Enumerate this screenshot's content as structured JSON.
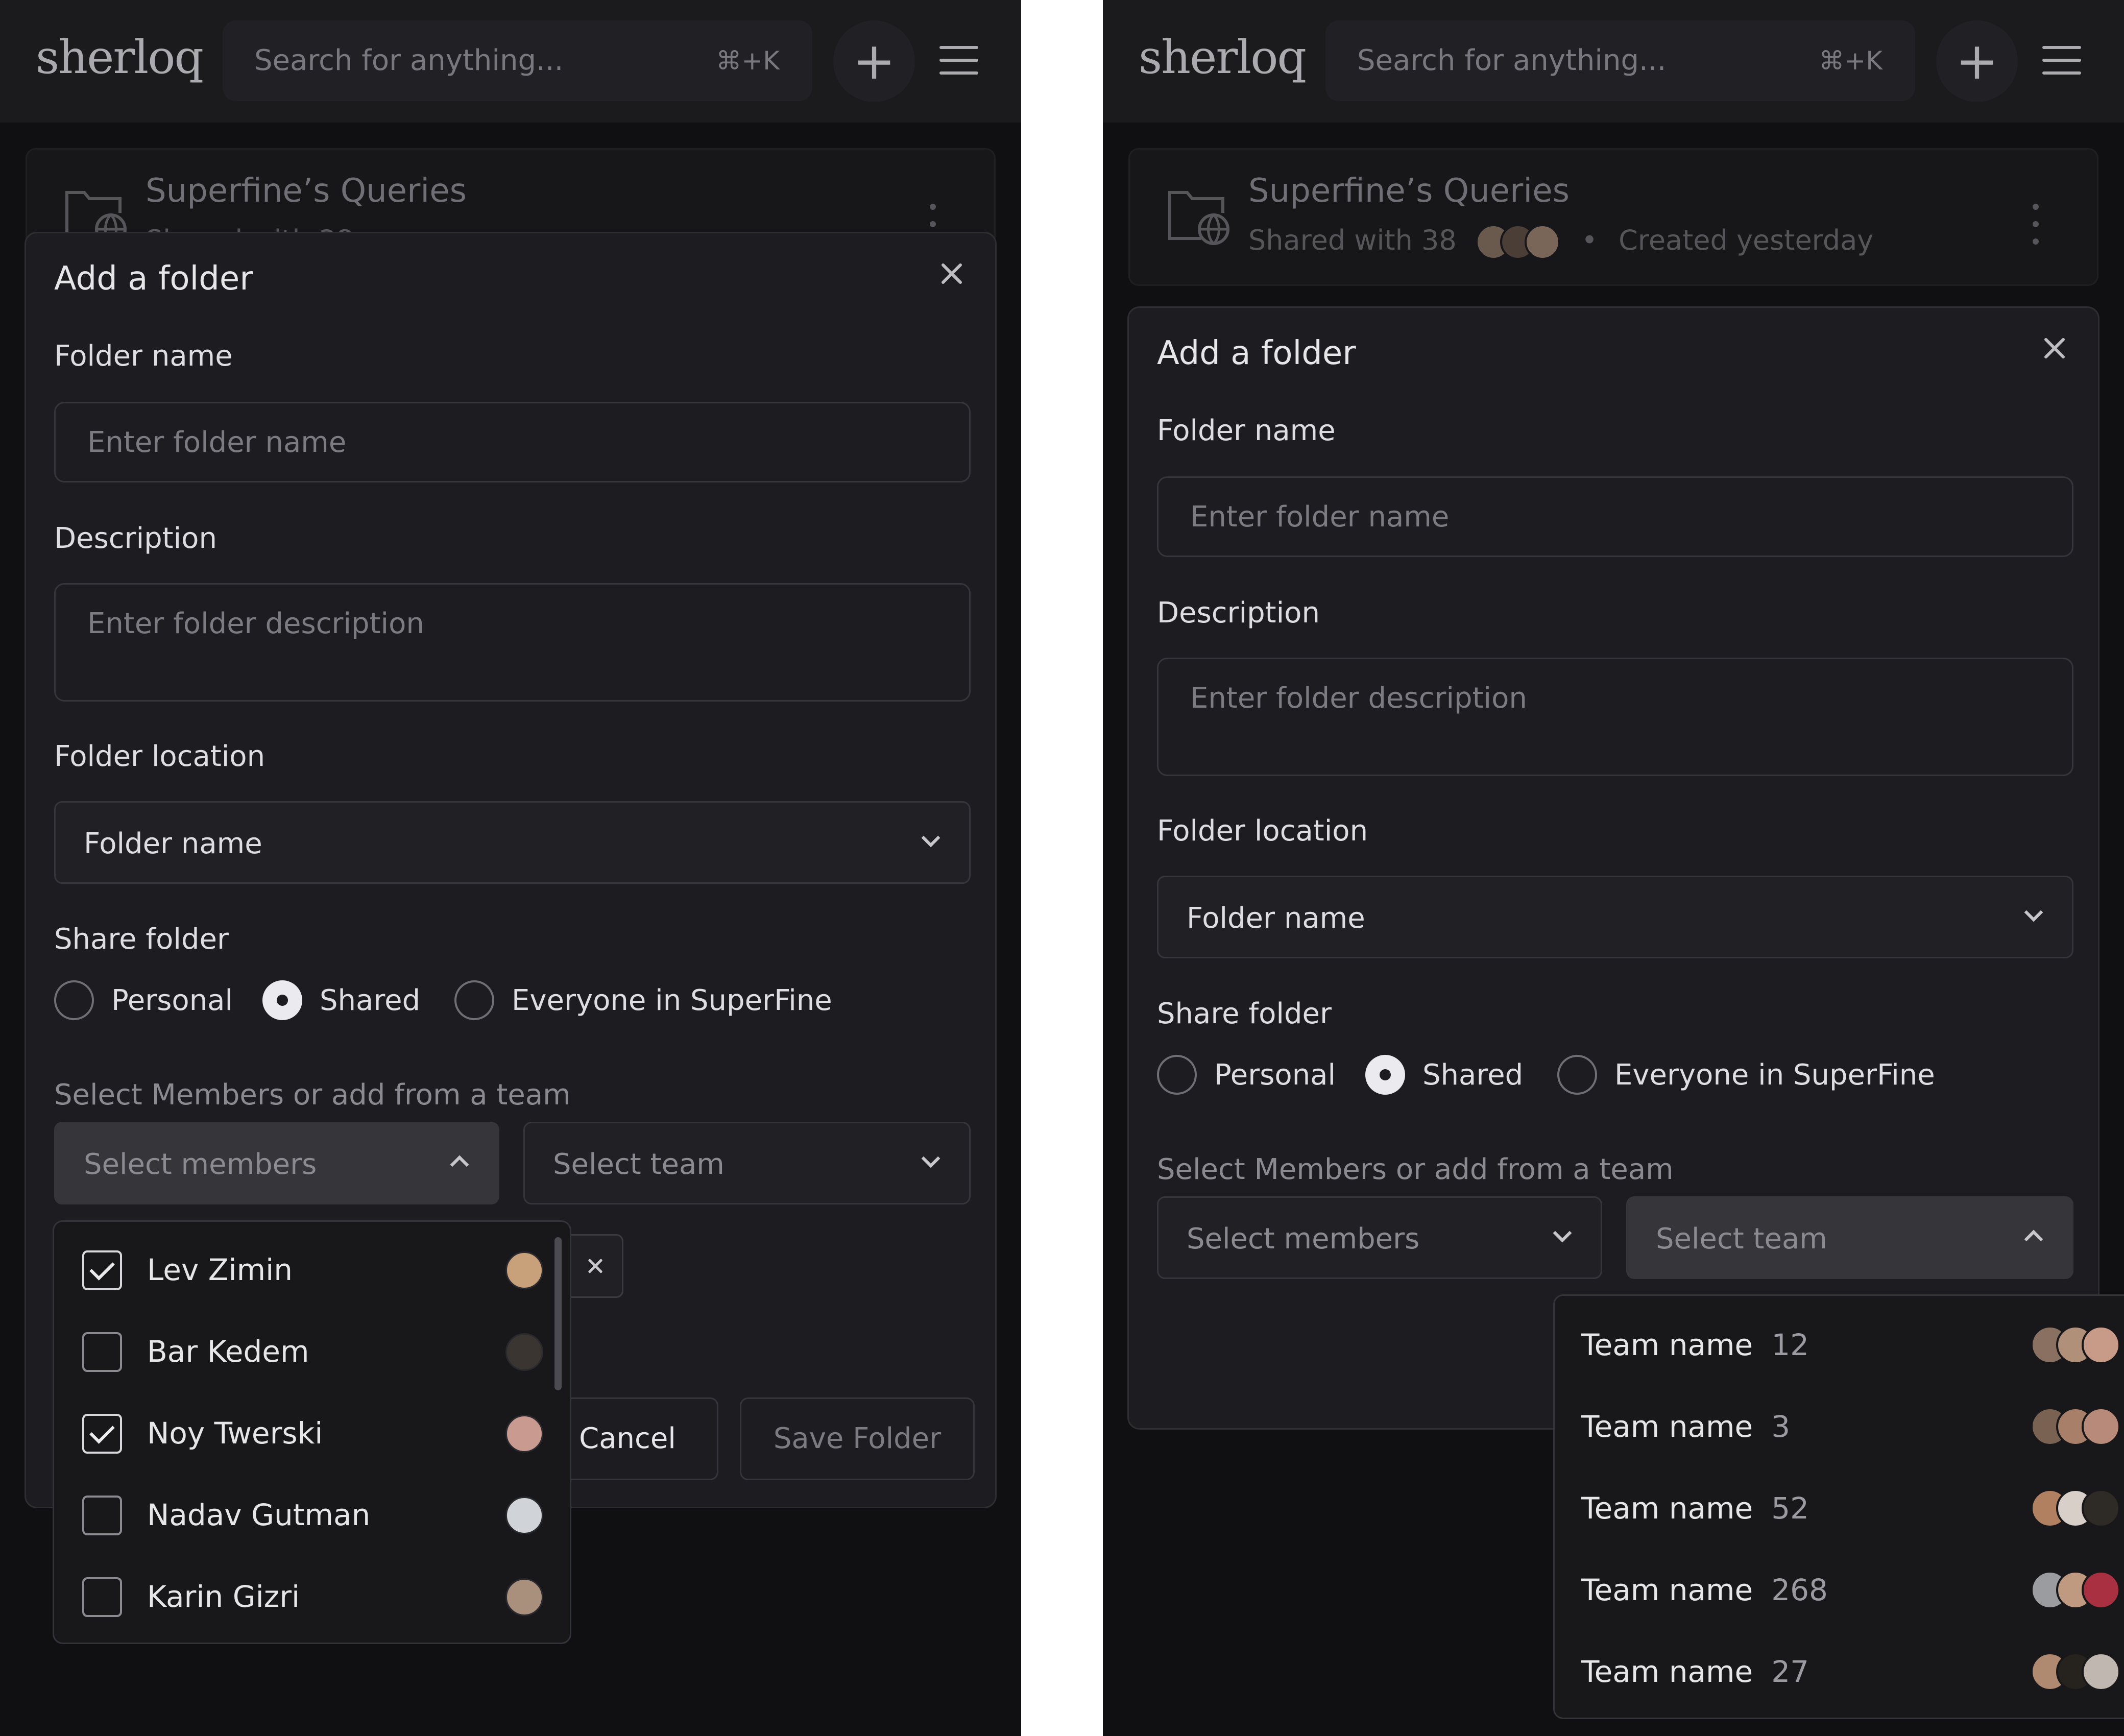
{
  "app": {
    "logo": "sherloq",
    "search": {
      "placeholder": "Search for anything...",
      "shortcut": "⌘+K"
    }
  },
  "folder_card": {
    "title": "Superfine’s Queries",
    "shared_with": "Shared with 38",
    "separator": "•",
    "created": "Created yesterday"
  },
  "dialog": {
    "title": "Add a folder",
    "folder_name": {
      "label": "Folder name",
      "placeholder": "Enter folder name"
    },
    "description": {
      "label": "Description",
      "placeholder": "Enter folder description"
    },
    "folder_location": {
      "label": "Folder location",
      "value": "Folder name"
    },
    "share_folder": {
      "label": "Share folder",
      "options": [
        "Personal",
        "Shared",
        "Everyone in SuperFine"
      ],
      "selected": "Shared"
    },
    "members_hint": "Select Members or add from a team",
    "select_members": "Select members",
    "select_team": "Select team",
    "cancel": "Cancel",
    "save": "Save Folder"
  },
  "members": [
    {
      "name": "Lev Zimin",
      "checked": true,
      "avatar_color": "#c8a07a"
    },
    {
      "name": "Bar Kedem",
      "checked": false,
      "avatar_color": "#3a3530"
    },
    {
      "name": "Noy Twerski",
      "checked": true,
      "avatar_color": "#c99a90"
    },
    {
      "name": "Nadav Gutman",
      "checked": false,
      "avatar_color": "#d0d4d8"
    },
    {
      "name": "Karin Gizri",
      "checked": false,
      "avatar_color": "#a8907c"
    }
  ],
  "teams": [
    {
      "name": "Team name",
      "count": "12",
      "avatar_colors": [
        "#8a7060",
        "#b09078",
        "#c89a88"
      ]
    },
    {
      "name": "Team name",
      "count": "3",
      "avatar_colors": [
        "#7a6252",
        "#a8806a",
        "#b88a7a"
      ]
    },
    {
      "name": "Team name",
      "count": "52",
      "avatar_colors": [
        "#b08060",
        "#d8d0c8",
        "#2e2a26"
      ]
    },
    {
      "name": "Team name",
      "count": "268",
      "avatar_colors": [
        "#9a9ca0",
        "#c09a80",
        "#a83040"
      ]
    },
    {
      "name": "Team name",
      "count": "27",
      "avatar_colors": [
        "#b08a70",
        "#26221e",
        "#c0b8b0"
      ]
    }
  ],
  "colors": {
    "background": "#101012",
    "surface": "#1d1d21",
    "border": "#35353b",
    "text": "#e6e6e9",
    "muted": "#8a8a90"
  }
}
